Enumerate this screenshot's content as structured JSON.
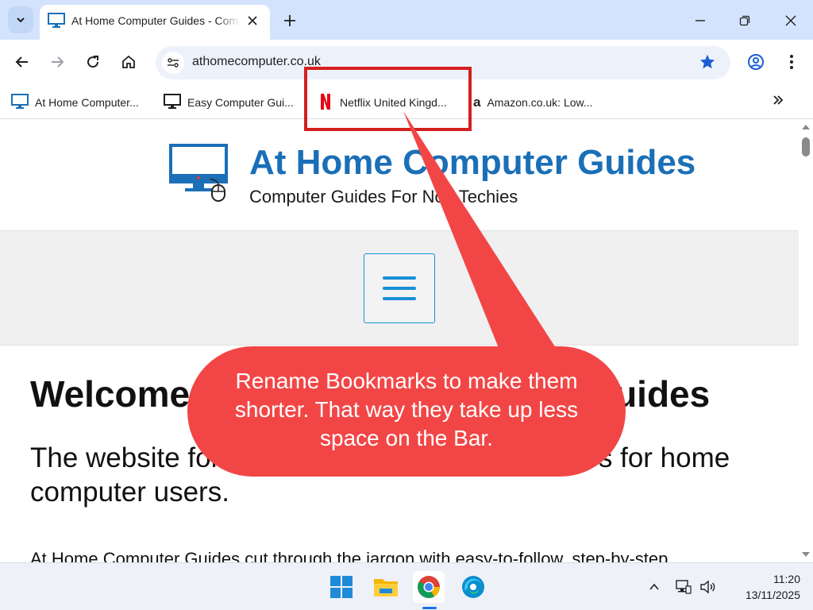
{
  "browser": {
    "tab": {
      "title": "At Home Computer Guides - Computer Guides For Non Techies"
    },
    "omnibox": {
      "url": "athomecomputer.co.uk"
    },
    "bookmarks": [
      {
        "label": "At Home Computer...",
        "icon": "monitor-icon"
      },
      {
        "label": "Easy Computer Gui...",
        "icon": "monitor-icon"
      },
      {
        "label": "Netflix United Kingd...",
        "icon": "netflix-icon"
      },
      {
        "label": "Amazon.co.uk: Low...",
        "icon": "amazon-icon"
      }
    ]
  },
  "site": {
    "title": "At Home Computer Guides",
    "tagline": "Computer Guides For Non Techies",
    "welcome": "Welcome to At Home Computer Guides",
    "subhead": "The website for easy-to-follow computer guides for home computer users.",
    "intro": "At Home Computer Guides cut through the jargon with easy-to-follow, step-by-step"
  },
  "callout": {
    "text": "Rename Bookmarks to make them shorter. That way they take up less space on the Bar."
  },
  "taskbar": {
    "time": "11:20",
    "date": "13/11/2025",
    "apps": [
      "windows-start-icon",
      "file-explorer-icon",
      "chrome-icon",
      "edge-icon"
    ]
  },
  "colors": {
    "callout": "#f24646",
    "highlight": "#d51f1f",
    "brand_blue": "#1a6fb7",
    "tabstrip": "#d3e3fd"
  }
}
